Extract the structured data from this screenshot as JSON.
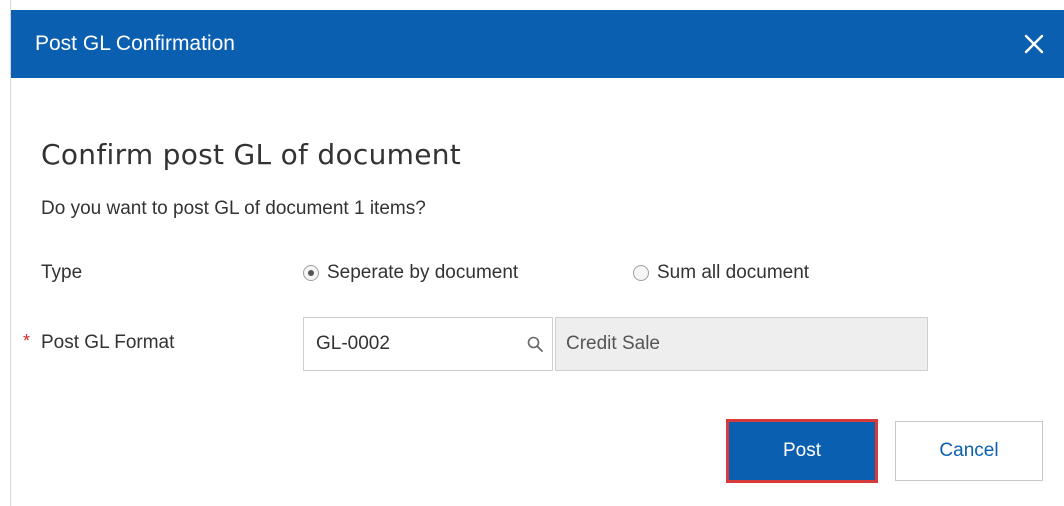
{
  "dialog": {
    "title": "Post GL Confirmation",
    "heading": "Confirm post GL of document",
    "question": "Do you want to post GL of document 1 items?"
  },
  "type_field": {
    "label": "Type",
    "options": [
      {
        "label": "Seperate by document",
        "selected": true
      },
      {
        "label": "Sum all document",
        "selected": false
      }
    ]
  },
  "format_field": {
    "required_marker": "*",
    "label": "Post GL Format",
    "code": "GL-0002",
    "description": "Credit Sale"
  },
  "buttons": {
    "post": "Post",
    "cancel": "Cancel"
  },
  "colors": {
    "header": "#0b5fb0",
    "primary": "#0b5fb0",
    "required": "#d22b2b",
    "highlight_border": "#d63a3a"
  },
  "icons": {
    "close": "close-icon",
    "search": "search-icon"
  }
}
